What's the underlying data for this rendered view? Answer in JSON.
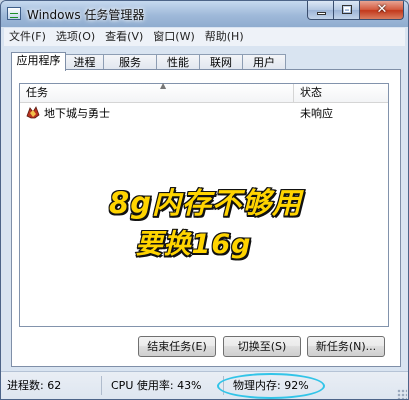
{
  "window": {
    "title": "Windows 任务管理器"
  },
  "menu": [
    "文件(F)",
    "选项(O)",
    "查看(V)",
    "窗口(W)",
    "帮助(H)"
  ],
  "tabs": [
    "应用程序",
    "进程",
    "服务",
    "性能",
    "联网",
    "用户"
  ],
  "active_tab": "应用程序",
  "list": {
    "columns": {
      "task": "任务",
      "status": "状态"
    },
    "rows": [
      {
        "task": "地下城与勇士",
        "status": "未响应",
        "icon": "game-icon"
      }
    ]
  },
  "overlay": {
    "line1": "8g内存不够用",
    "line2": "要换16g",
    "color": "#ffd400"
  },
  "buttons": {
    "end_task": "结束任务(E)",
    "switch_to": "切换至(S)",
    "new_task": "新任务(N)..."
  },
  "statusbar": {
    "processes": "进程数: 62",
    "cpu": "CPU 使用率: 43%",
    "memory": "物理内存: 92%"
  },
  "colors": {
    "highlight_ring": "#32c4e8",
    "close_button": "#c2381b"
  }
}
